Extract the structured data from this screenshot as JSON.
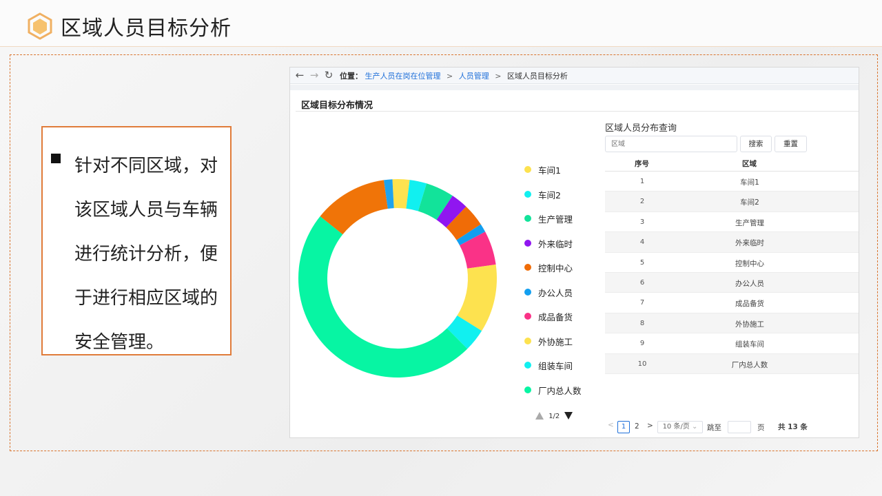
{
  "slide": {
    "title": "区域人员目标分析",
    "bullet": "针对不同区域，对该区域人员与车辆进行统计分析，便于进行相应区域的安全管理。",
    "accent_color": "#e07b39"
  },
  "app": {
    "nav": {
      "back_icon": "arrow-left-icon",
      "forward_icon": "arrow-right-icon",
      "refresh_icon": "refresh-icon"
    },
    "breadcrumb": {
      "label": "位置：",
      "items": [
        "生产人员在岗在位管理",
        "人员管理",
        "区域人员目标分析"
      ]
    },
    "section_title": "区域目标分布情况",
    "query": {
      "title": "区域人员分布查询",
      "placeholder": "区域",
      "search_label": "搜索",
      "reset_label": "重置"
    },
    "table": {
      "columns": [
        "序号",
        "区域"
      ],
      "rows": [
        [
          "1",
          "车间1"
        ],
        [
          "2",
          "车间2"
        ],
        [
          "3",
          "生产管理"
        ],
        [
          "4",
          "外来临时"
        ],
        [
          "5",
          "控制中心"
        ],
        [
          "6",
          "办公人员"
        ],
        [
          "7",
          "成品备货"
        ],
        [
          "8",
          "外协施工"
        ],
        [
          "9",
          "组装车间"
        ],
        [
          "10",
          "厂内总人数"
        ]
      ]
    },
    "pagination": {
      "prev": "<",
      "pages": [
        "1",
        "2"
      ],
      "current": "1",
      "next": ">",
      "page_size": "10 条/页",
      "goto_label": "跳至",
      "page_unit": "页",
      "total": "共 13 条"
    },
    "legend_pager": "1/2"
  },
  "chart_data": {
    "type": "pie",
    "donut": true,
    "categories": [
      "车间1",
      "车间2",
      "生产管理",
      "外来临时",
      "控制中心",
      "办公人员",
      "成品备货",
      "外协施工",
      "组装车间",
      "厂内总人数",
      "",
      ""
    ],
    "values": [
      3,
      3,
      5,
      3,
      4,
      1.5,
      6,
      12,
      4,
      52,
      13,
      1.5
    ],
    "colors": [
      "#fde24f",
      "#11f0f0",
      "#12e39a",
      "#9016f0",
      "#f06c07",
      "#129ff0",
      "#fa3287",
      "#fde24f",
      "#11f0f0",
      "#07f5a3",
      "#f07408",
      "#1ea3ee"
    ],
    "start_angle_deg": -3,
    "legend": [
      "车间1",
      "车间2",
      "生产管理",
      "外来临时",
      "控制中心",
      "办公人员",
      "成品备货",
      "外协施工",
      "组装车间",
      "厂内总人数"
    ],
    "legend_placement": "right"
  }
}
